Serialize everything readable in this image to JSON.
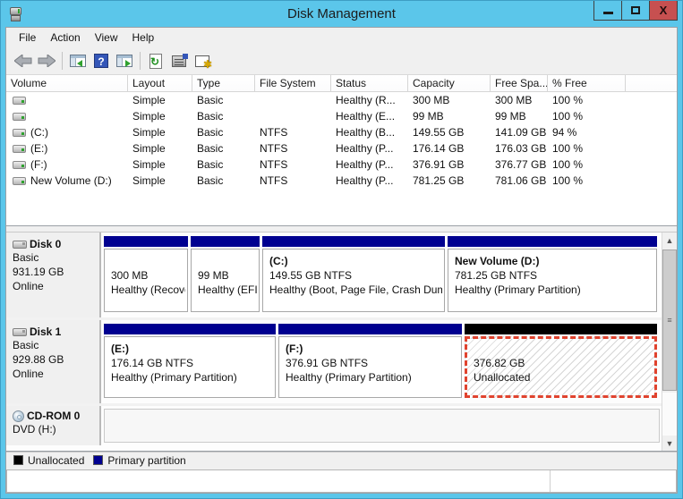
{
  "window": {
    "title": "Disk Management"
  },
  "menu": {
    "items": [
      {
        "label": "File"
      },
      {
        "label": "Action"
      },
      {
        "label": "View"
      },
      {
        "label": "Help"
      }
    ]
  },
  "toolbar": {
    "icons": [
      "back-icon",
      "forward-icon",
      "show-console-tree-icon",
      "help-icon",
      "show-action-pane-icon",
      "refresh-icon",
      "properties-icon",
      "disk-settings-icon"
    ]
  },
  "colors": {
    "titlebar": "#5bc6ea",
    "close_button": "#c75050",
    "primary_partition": "#000090",
    "unallocated": "#000000",
    "selection_dash": "#e0432e"
  },
  "volume_table": {
    "columns": [
      "Volume",
      "Layout",
      "Type",
      "File System",
      "Status",
      "Capacity",
      "Free Spa...",
      "% Free"
    ],
    "rows": [
      {
        "name": "",
        "layout": "Simple",
        "type": "Basic",
        "fs": "",
        "status": "Healthy (R...",
        "capacity": "300 MB",
        "free": "300 MB",
        "pct": "100 %"
      },
      {
        "name": "",
        "layout": "Simple",
        "type": "Basic",
        "fs": "",
        "status": "Healthy (E...",
        "capacity": "99 MB",
        "free": "99 MB",
        "pct": "100 %"
      },
      {
        "name": "(C:)",
        "layout": "Simple",
        "type": "Basic",
        "fs": "NTFS",
        "status": "Healthy (B...",
        "capacity": "149.55 GB",
        "free": "141.09 GB",
        "pct": "94 %"
      },
      {
        "name": "(E:)",
        "layout": "Simple",
        "type": "Basic",
        "fs": "NTFS",
        "status": "Healthy (P...",
        "capacity": "176.14 GB",
        "free": "176.03 GB",
        "pct": "100 %"
      },
      {
        "name": "(F:)",
        "layout": "Simple",
        "type": "Basic",
        "fs": "NTFS",
        "status": "Healthy (P...",
        "capacity": "376.91 GB",
        "free": "376.77 GB",
        "pct": "100 %"
      },
      {
        "name": "New Volume (D:)",
        "layout": "Simple",
        "type": "Basic",
        "fs": "NTFS",
        "status": "Healthy (P...",
        "capacity": "781.25 GB",
        "free": "781.06 GB",
        "pct": "100 %"
      }
    ]
  },
  "graph": {
    "disks": [
      {
        "label": "Disk 0",
        "kind": "Basic",
        "size": "931.19 GB",
        "status": "Online",
        "partitions": [
          {
            "name": "",
            "size": "300 MB",
            "health": "Healthy (Recovery Partition)",
            "bar": "#000090"
          },
          {
            "name": "",
            "size": "99 MB",
            "health": "Healthy (EFI System Partition)",
            "bar": "#000090"
          },
          {
            "name": "(C:)",
            "size": "149.55 GB NTFS",
            "health": "Healthy (Boot, Page File, Crash Dump, Primary Partition)",
            "bar": "#000090"
          },
          {
            "name": "New Volume  (D:)",
            "size": "781.25 GB NTFS",
            "health": "Healthy (Primary Partition)",
            "bar": "#000090"
          }
        ]
      },
      {
        "label": "Disk 1",
        "kind": "Basic",
        "size": "929.88 GB",
        "status": "Online",
        "partitions": [
          {
            "name": "(E:)",
            "size": "176.14 GB NTFS",
            "health": "Healthy (Primary Partition)",
            "bar": "#000090"
          },
          {
            "name": "(F:)",
            "size": "376.91 GB NTFS",
            "health": "Healthy (Primary Partition)",
            "bar": "#000090"
          },
          {
            "name": "",
            "size": "376.82 GB",
            "health": "Unallocated",
            "bar": "#000000"
          }
        ]
      }
    ],
    "cdrom": {
      "label": "CD-ROM 0",
      "media": "DVD (H:)"
    }
  },
  "legend": {
    "items": [
      {
        "label": "Unallocated",
        "color": "#000000"
      },
      {
        "label": "Primary partition",
        "color": "#000090"
      }
    ]
  }
}
